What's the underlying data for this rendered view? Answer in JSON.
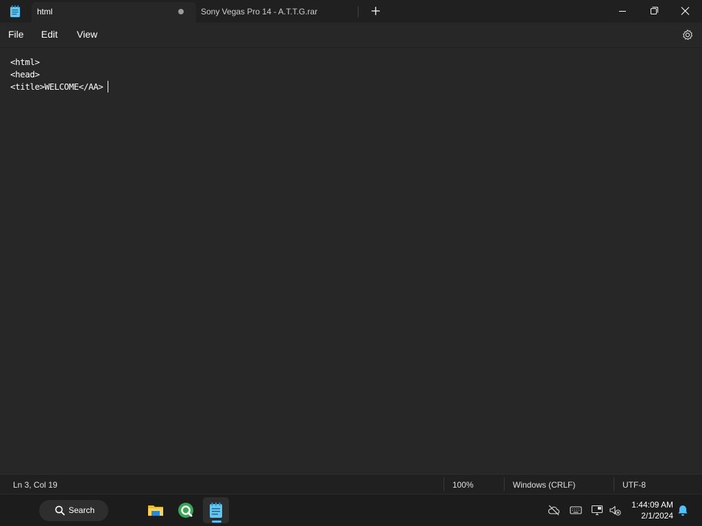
{
  "titlebar": {
    "active_tab": "html",
    "inactive_tab": "Sony Vegas Pro 14 - A.T.T.G.rar",
    "new_tab_icon": "plus-icon",
    "window_controls": [
      "minimize-icon",
      "maximize-icon",
      "close-icon"
    ]
  },
  "menu": {
    "items": [
      "File",
      "Edit",
      "View"
    ],
    "settings_icon": "gear-icon"
  },
  "editor": {
    "lines": [
      "<html>",
      "<head>",
      "<title>WELCOME</AA>"
    ]
  },
  "status": {
    "position": "Ln 3, Col 19",
    "zoom": "100%",
    "line_ending": "Windows (CRLF)",
    "encoding": "UTF-8"
  },
  "taskbar": {
    "search_label": "Search",
    "apps": [
      "file-explorer-icon",
      "qlik-icon",
      "notepad-icon"
    ],
    "tray": [
      "cloud-offline-icon",
      "keyboard-icon",
      "network-icon",
      "volume-muted-icon",
      "bell-icon"
    ],
    "time": "1:44:09 AM",
    "date": "2/1/2024"
  },
  "colors": {
    "accent": "#4cc2ff",
    "background": "#272727",
    "chrome": "#202020",
    "taskbar": "#1c1c1c"
  }
}
